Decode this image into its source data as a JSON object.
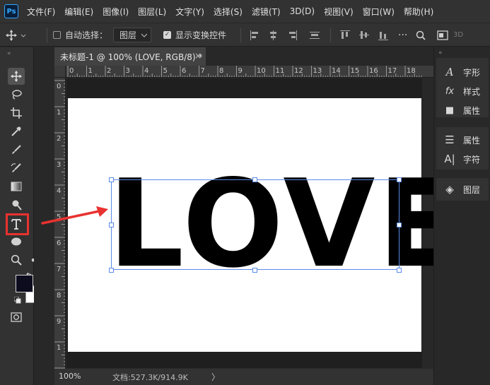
{
  "app": {
    "logo": "Ps"
  },
  "menu": [
    "文件(F)",
    "编辑(E)",
    "图像(I)",
    "图层(L)",
    "文字(Y)",
    "选择(S)",
    "滤镜(T)",
    "3D(D)",
    "视图(V)",
    "窗口(W)",
    "帮助(H)"
  ],
  "options_bar": {
    "auto_select_label": "自动选择：",
    "auto_select_checked": false,
    "target_value": "图层",
    "show_transform_label": "显示变换控件",
    "show_transform_checked": true,
    "mode_3d_label": "3D"
  },
  "document_tab": {
    "title": "未标题-1 @ 100% (LOVE, RGB/8) *",
    "close": "×"
  },
  "ruler": {
    "h_labels": [
      "0",
      "1",
      "2",
      "3",
      "4",
      "5",
      "6",
      "7",
      "8",
      "9",
      "10",
      "11",
      "12",
      "13",
      "14",
      "15",
      "16",
      "17",
      "18"
    ],
    "v_labels": [
      "0",
      "1",
      "2",
      "3",
      "4",
      "5",
      "6",
      "7",
      "8",
      "9",
      "1",
      "1"
    ]
  },
  "canvas": {
    "text_layer": "LOVE",
    "selection_color": "#5a8ae8",
    "text_color": "#000000",
    "background": "#ffffff"
  },
  "status": {
    "zoom": "100%",
    "doc_info": "文档:527.3K/914.9K",
    "arrow": "〉"
  },
  "right_panel": {
    "group1": [
      {
        "icon": "character-icon",
        "glyph": "A",
        "label": "字形"
      },
      {
        "icon": "fx-icon",
        "glyph": "fx",
        "label": "样式"
      },
      {
        "icon": "properties-icon",
        "glyph": "■",
        "label": "属性"
      }
    ],
    "group2": [
      {
        "icon": "adjust-icon",
        "glyph": "☰",
        "label": "属性"
      },
      {
        "icon": "character-panel-icon",
        "glyph": "A|",
        "label": "字符"
      }
    ],
    "group3": [
      {
        "icon": "layers-icon",
        "glyph": "◈",
        "label": "图层"
      }
    ]
  },
  "colors": {
    "foreground": "#0c0c1e",
    "background": "#ffffff",
    "annotation": "#e8322f"
  }
}
